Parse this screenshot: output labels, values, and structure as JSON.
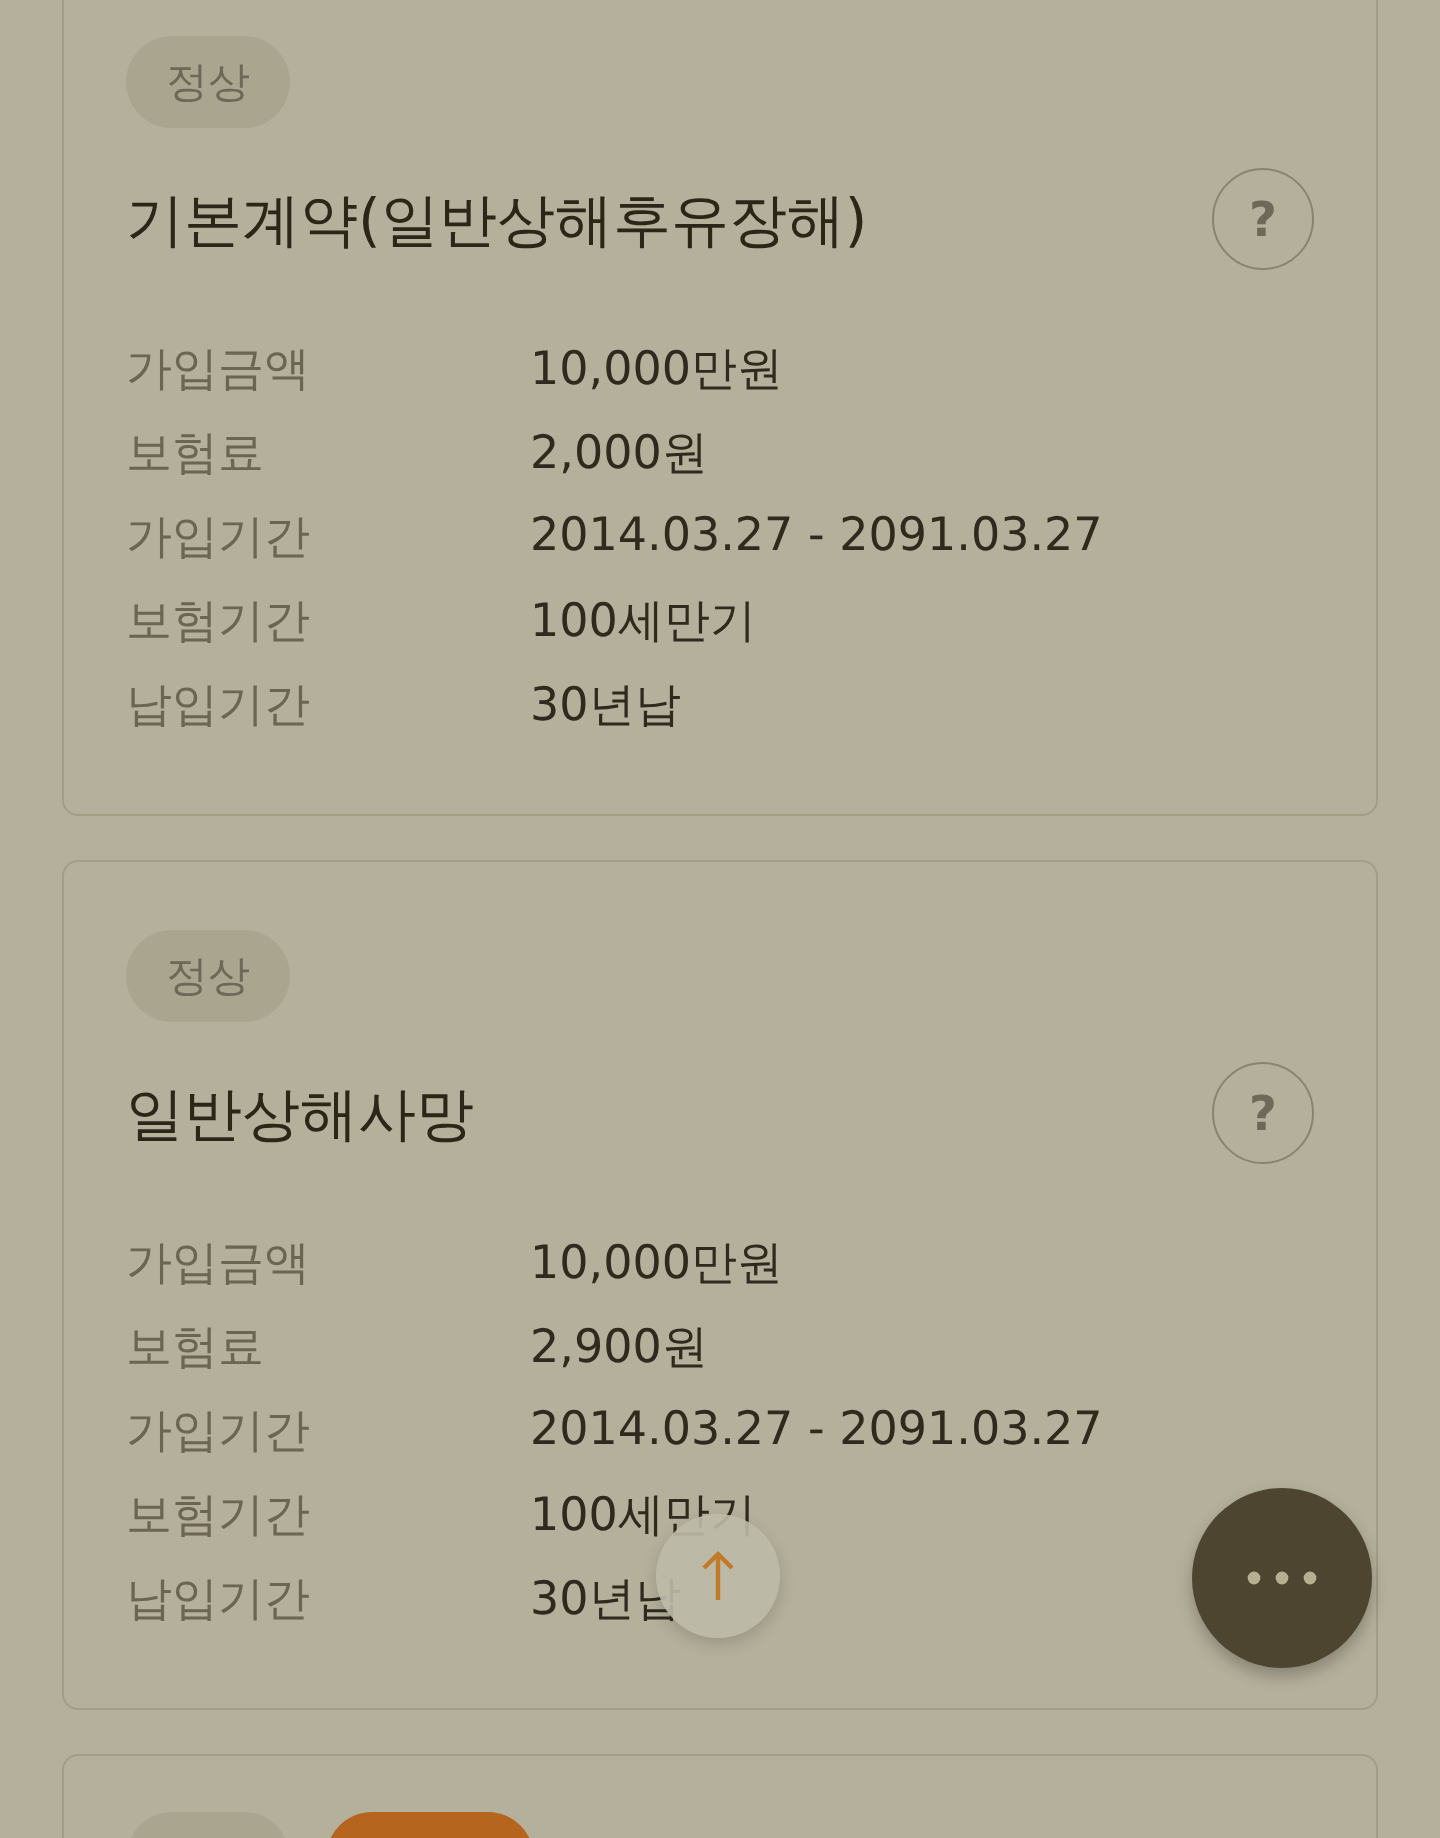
{
  "cards": [
    {
      "badges": [
        {
          "label": "정상",
          "color": "#aaa58f"
        }
      ],
      "title": "기본계약(일반상해후유장해)",
      "help": "?",
      "rows": [
        {
          "label": "가입금액",
          "value": "10,000만원"
        },
        {
          "label": "보험료",
          "value": "2,000원"
        },
        {
          "label": "가입기간",
          "value": "2014.03.27 - 2091.03.27"
        },
        {
          "label": "보험기간",
          "value": "100세만기"
        },
        {
          "label": "납입기간",
          "value": "30년납"
        }
      ]
    },
    {
      "badges": [
        {
          "label": "정상",
          "color": "#aaa58f"
        }
      ],
      "title": "일반상해사망",
      "help": "?",
      "rows": [
        {
          "label": "가입금액",
          "value": "10,000만원"
        },
        {
          "label": "보험료",
          "value": "2,900원"
        },
        {
          "label": "가입기간",
          "value": "2014.03.27 - 2091.03.27"
        },
        {
          "label": "보험기간",
          "value": "100세만기"
        },
        {
          "label": "납입기간",
          "value": "30년납"
        }
      ]
    },
    {
      "badges": [
        {
          "color": "#aaa58f"
        },
        {
          "color": "#b5651d"
        }
      ]
    }
  ]
}
